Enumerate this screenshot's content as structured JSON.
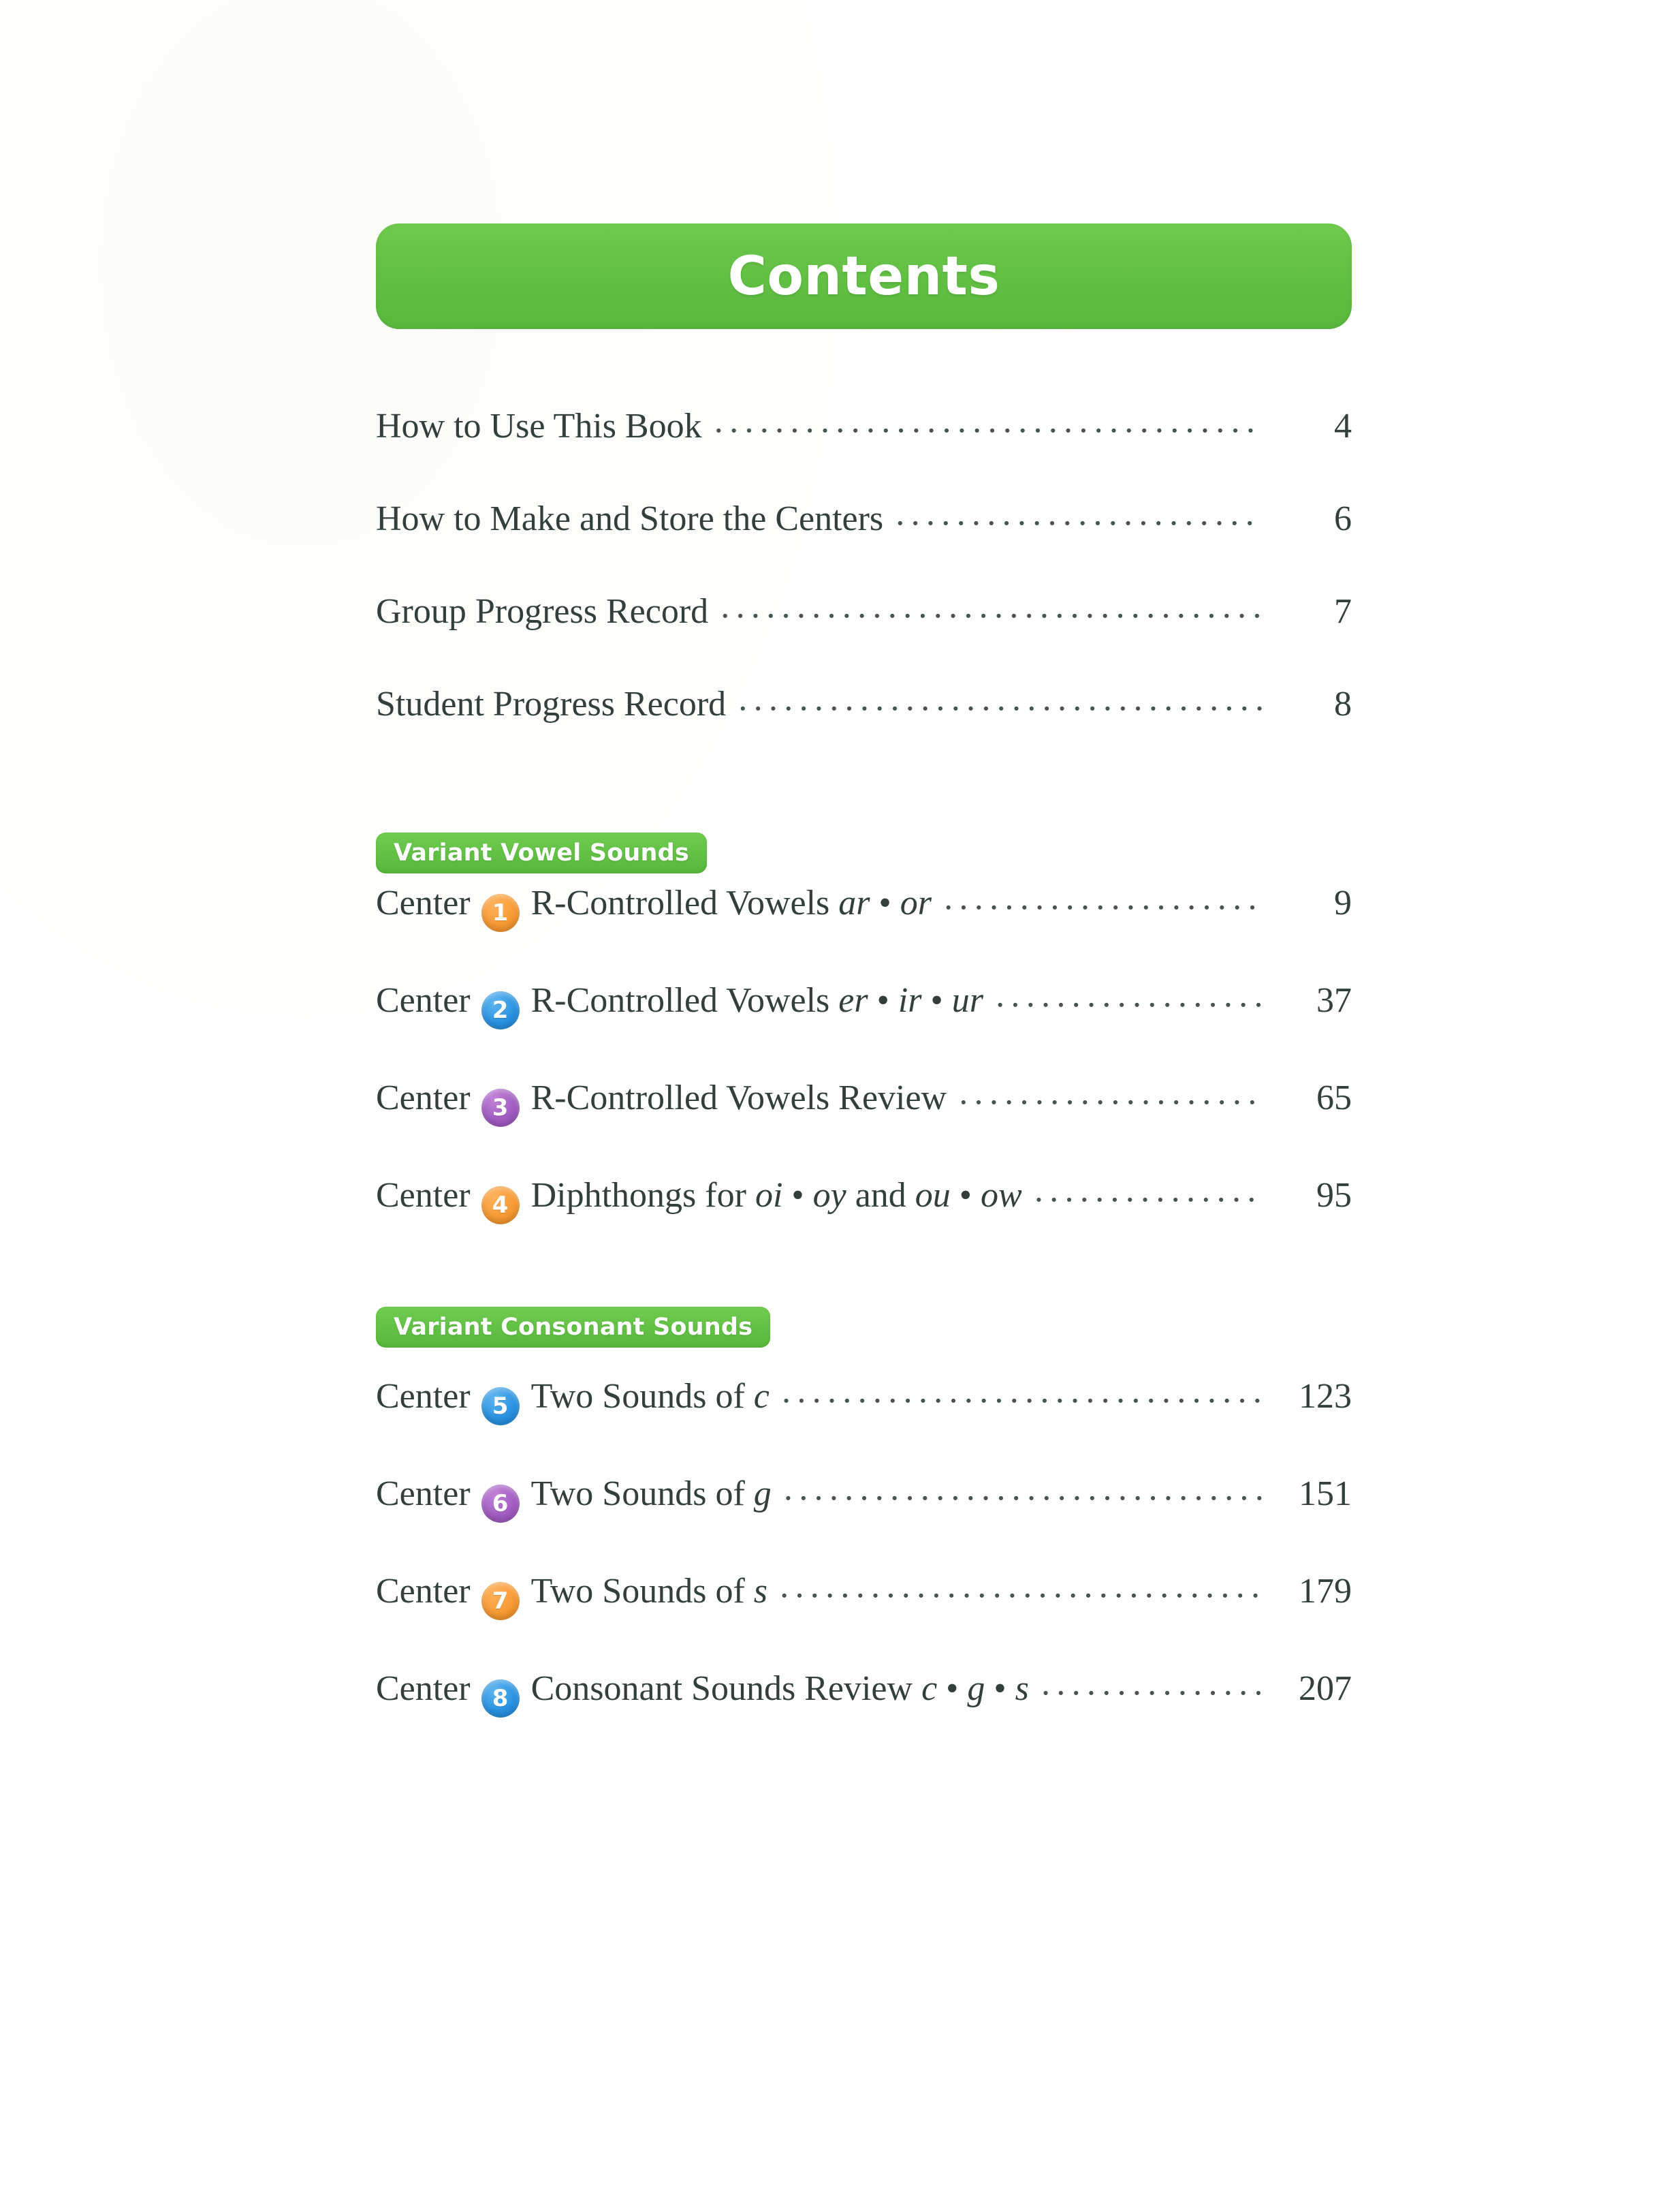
{
  "header": {
    "title": "Contents",
    "banner_color": "#62c044",
    "title_color": "#ffffff"
  },
  "colors": {
    "green": "#62c044",
    "text": "#333f3a",
    "orange": "#f79a34",
    "blue": "#2a93e2",
    "purple": "#a25cc2"
  },
  "front_matter": [
    {
      "label": "How to Use This Book",
      "page": "4"
    },
    {
      "label": "How to Make and Store the Centers",
      "page": "6"
    },
    {
      "label": "Group Progress Record",
      "page": "7"
    },
    {
      "label": "Student Progress Record",
      "page": "8"
    }
  ],
  "sections": [
    {
      "heading": "Variant Vowel Sounds",
      "entries": [
        {
          "center_word": "Center",
          "number": "1",
          "badge_color": "orange",
          "title_plain_1": "R-Controlled Vowels ",
          "title_italic_1": "ar",
          "title_plain_2": " • ",
          "title_italic_2": "or",
          "title_plain_3": "",
          "title_italic_3": "",
          "page": "9"
        },
        {
          "center_word": "Center",
          "number": "2",
          "badge_color": "blue",
          "title_plain_1": "R-Controlled Vowels ",
          "title_italic_1": "er",
          "title_plain_2": " • ",
          "title_italic_2": "ir",
          "title_plain_3": " • ",
          "title_italic_3": "ur",
          "page": "37"
        },
        {
          "center_word": "Center",
          "number": "3",
          "badge_color": "purple",
          "title_plain_1": "R-Controlled Vowels Review",
          "title_italic_1": "",
          "title_plain_2": "",
          "title_italic_2": "",
          "title_plain_3": "",
          "title_italic_3": "",
          "page": "65"
        },
        {
          "center_word": "Center",
          "number": "4",
          "badge_color": "orange",
          "title_plain_1": "Diphthongs for ",
          "title_italic_1": "oi",
          "title_plain_2": " • ",
          "title_italic_2": "oy",
          "title_plain_3": " and ",
          "title_italic_3": "ou",
          "title_plain_4": " • ",
          "title_italic_4": "ow",
          "page": "95"
        }
      ]
    },
    {
      "heading": "Variant Consonant Sounds",
      "entries": [
        {
          "center_word": "Center",
          "number": "5",
          "badge_color": "blue",
          "title_plain_1": "Two Sounds of ",
          "title_italic_1": "c",
          "title_plain_2": "",
          "title_italic_2": "",
          "title_plain_3": "",
          "title_italic_3": "",
          "page": "123"
        },
        {
          "center_word": "Center",
          "number": "6",
          "badge_color": "purple",
          "title_plain_1": "Two Sounds of ",
          "title_italic_1": "g",
          "title_plain_2": "",
          "title_italic_2": "",
          "title_plain_3": "",
          "title_italic_3": "",
          "page": "151"
        },
        {
          "center_word": "Center",
          "number": "7",
          "badge_color": "orange",
          "title_plain_1": "Two Sounds of ",
          "title_italic_1": "s",
          "title_plain_2": "",
          "title_italic_2": "",
          "title_plain_3": "",
          "title_italic_3": "",
          "page": "179"
        },
        {
          "center_word": "Center",
          "number": "8",
          "badge_color": "blue",
          "title_plain_1": "Consonant Sounds Review ",
          "title_italic_1": "c",
          "title_plain_2": " • ",
          "title_italic_2": "g",
          "title_plain_3": " • ",
          "title_italic_3": "s",
          "page": "207"
        }
      ]
    }
  ],
  "leader": {
    "glyph": "·"
  }
}
